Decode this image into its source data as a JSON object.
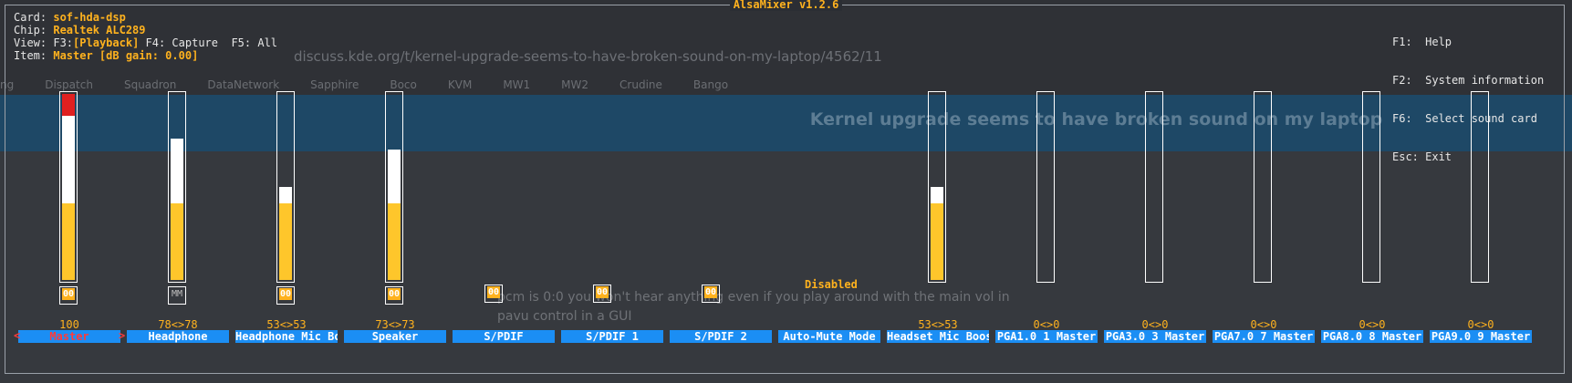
{
  "window": {
    "title": "AlsaMixer v1.2.6"
  },
  "info": {
    "card_label": "Card:",
    "card_value": "sof-hda-dsp",
    "chip_label": "Chip:",
    "chip_value": "Realtek ALC289",
    "view_label": "View:",
    "view_f3": "F3:",
    "view_playback": "[Playback]",
    "view_rest": " F4: Capture  F5: All",
    "item_label": "Item:",
    "item_value": "Master [dB gain: 0.00]"
  },
  "help": [
    "F1:  Help",
    "F2:  System information",
    "F6:  Select sound card",
    "Esc: Exit"
  ],
  "controls": [
    {
      "name": "Master",
      "volume": "100",
      "level_pct": 100,
      "red_pct": 12,
      "white_pct": 43,
      "switch": "00",
      "active": true
    },
    {
      "name": "Headphone",
      "volume": "78<>78",
      "level_pct": 76,
      "switch": "MM",
      "active": false
    },
    {
      "name": "Headphone Mic Bo",
      "volume": "53<>53",
      "level_pct": 50,
      "switch": "00",
      "active": false
    },
    {
      "name": "Speaker",
      "volume": "73<>73",
      "level_pct": 70,
      "switch": "00",
      "active": false
    },
    {
      "name": "S/PDIF",
      "volume": "",
      "switch": "00",
      "active": false
    },
    {
      "name": "S/PDIF 1",
      "volume": "",
      "switch": "00",
      "active": false
    },
    {
      "name": "S/PDIF 2",
      "volume": "",
      "switch": "00",
      "active": false
    },
    {
      "name": "Auto-Mute Mode",
      "volume": "",
      "enum_value": "Disabled",
      "active": false
    },
    {
      "name": "Headset Mic Boos",
      "volume": "53<>53",
      "level_pct": 50,
      "active": false
    },
    {
      "name": "PGA1.0 1 Master",
      "volume": "0<>0",
      "level_pct": 0,
      "active": false
    },
    {
      "name": "PGA3.0 3 Master",
      "volume": "0<>0",
      "level_pct": 0,
      "active": false
    },
    {
      "name": "PGA7.0 7 Master",
      "volume": "0<>0",
      "level_pct": 0,
      "active": false
    },
    {
      "name": "PGA8.0 8 Master",
      "volume": "0<>0",
      "level_pct": 0,
      "active": false
    },
    {
      "name": "PGA9.0 9 Master",
      "volume": "0<>0",
      "level_pct": 0,
      "active": false
    }
  ],
  "colors": {
    "accent": "#ffb21e",
    "selection": "#1b8ef4",
    "level": "#fec62b",
    "peak": "#e02020"
  },
  "background": {
    "url": "discuss.kde.org/t/kernel-upgrade-seems-to-have-broken-sound-on-my-laptop/4562/11",
    "bookmarks": [
      "ng",
      "Dispatch",
      "Squadron",
      "DataNetwork",
      "Sapphire",
      "Boco",
      "KVM",
      "MW1",
      "MW2",
      "Crudine",
      "Bango"
    ],
    "page_title": "Kernel upgrade seems to have broken sound on my laptop",
    "post_text": "pcm is 0:0 you won't hear anything even if you play around with the main vol in pavu control in a GUI"
  }
}
